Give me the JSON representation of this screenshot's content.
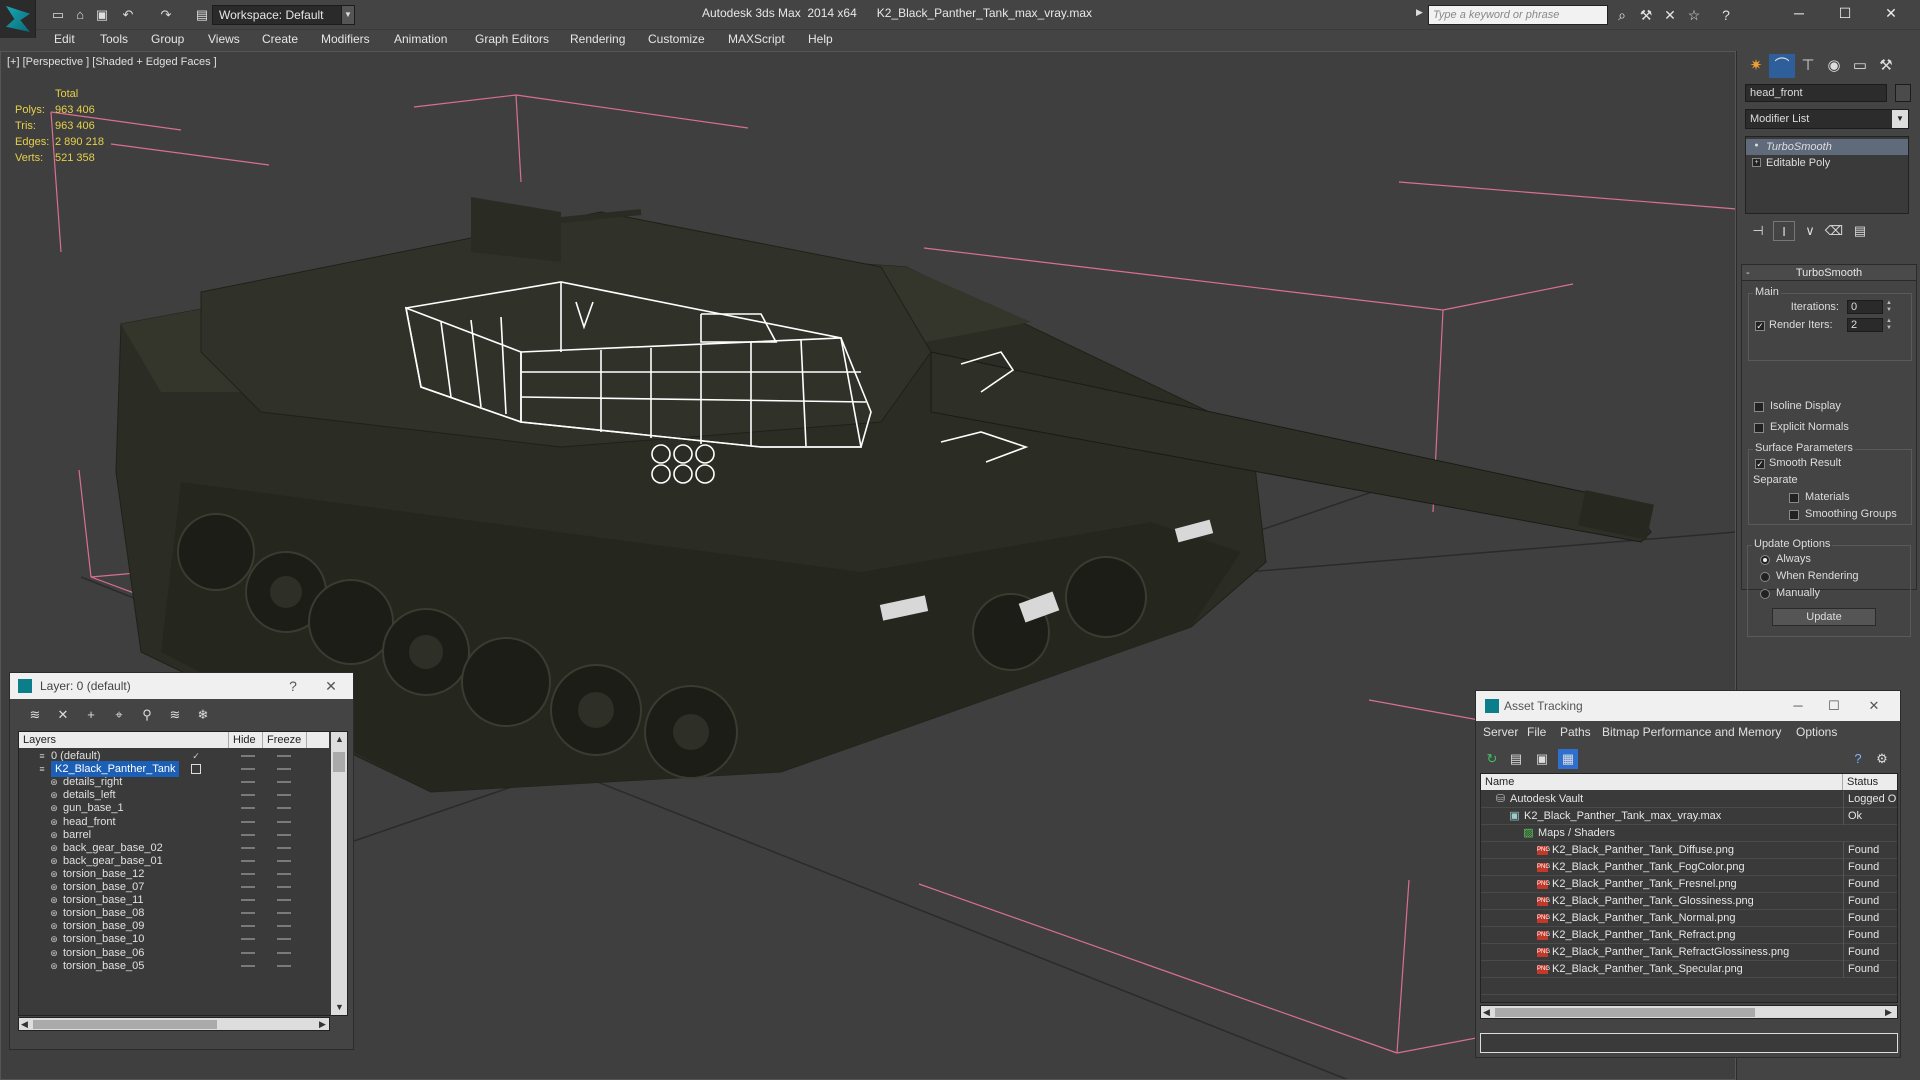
{
  "titlebar": {
    "app_title": "Autodesk 3ds Max  2014 x64      K2_Black_Panther_Tank_max_vray.max",
    "workspace": "Workspace: Default",
    "search_placeholder": "Type a keyword or phrase",
    "icons": [
      "app-logo-icon",
      "new-file-icon",
      "open-file-icon",
      "save-icon",
      "undo-icon",
      "redo-icon",
      "project-folder-icon",
      "binoculars-icon",
      "tools-icon",
      "exchange-icon",
      "star-icon",
      "help-icon",
      "minimize-icon",
      "maximize-icon",
      "close-icon"
    ]
  },
  "menu": {
    "items": [
      "Edit",
      "Tools",
      "Group",
      "Views",
      "Create",
      "Modifiers",
      "Animation",
      "Graph Editors",
      "Rendering",
      "Customize",
      "MAXScript",
      "Help"
    ]
  },
  "viewport": {
    "label": "[+] [Perspective ] [Shaded + Edged Faces ]",
    "stats": {
      "header": "Total",
      "rows": [
        {
          "label": "Polys:",
          "value": "963 406"
        },
        {
          "label": "Tris:",
          "value": "963 406"
        },
        {
          "label": "Edges:",
          "value": "2 890 218"
        },
        {
          "label": "Verts:",
          "value": "521 358"
        }
      ]
    },
    "colors": {
      "stats": "#e6d04a",
      "bbox": "#d9708f",
      "hull": "#2b2d24",
      "wire": "#ffffff"
    }
  },
  "command_panel": {
    "object_name": "head_front",
    "modifier_list": "Modifier List",
    "stack": [
      {
        "label": "TurboSmooth",
        "italic": true
      },
      {
        "label": "Editable Poly",
        "italic": false
      }
    ],
    "rollout": {
      "title": "TurboSmooth",
      "main_group": "Main",
      "iterations_label": "Iterations:",
      "iterations_value": "0",
      "render_iters_label": "Render Iters:",
      "render_iters_value": "2",
      "render_iters_checked": true,
      "isoline_label": "Isoline Display",
      "isoline_checked": false,
      "explicit_normals_label": "Explicit Normals",
      "explicit_normals_checked": false,
      "surface_group": "Surface Parameters",
      "smooth_result_label": "Smooth Result",
      "smooth_result_checked": true,
      "separate_label": "Separate",
      "materials_label": "Materials",
      "smoothing_groups_label": "Smoothing Groups",
      "update_group": "Update Options",
      "always_label": "Always",
      "when_rendering_label": "When Rendering",
      "manually_label": "Manually",
      "selected_update_option": "Always",
      "update_button": "Update"
    }
  },
  "layer_window": {
    "title": "Layer: 0 (default)",
    "help": "?",
    "columns": [
      "Layers",
      "Hide",
      "Freeze"
    ],
    "rows": [
      {
        "name": "0 (default)",
        "level": 0,
        "current": true
      },
      {
        "name": "K2_Black_Panther_Tank",
        "level": 0,
        "selected": true
      },
      {
        "name": "details_right",
        "level": 1
      },
      {
        "name": "details_left",
        "level": 1
      },
      {
        "name": "gun_base_1",
        "level": 1
      },
      {
        "name": "head_front",
        "level": 1
      },
      {
        "name": "barrel",
        "level": 1
      },
      {
        "name": "back_gear_base_02",
        "level": 1
      },
      {
        "name": "back_gear_base_01",
        "level": 1
      },
      {
        "name": "torsion_base_12",
        "level": 1
      },
      {
        "name": "torsion_base_07",
        "level": 1
      },
      {
        "name": "torsion_base_11",
        "level": 1
      },
      {
        "name": "torsion_base_08",
        "level": 1
      },
      {
        "name": "torsion_base_09",
        "level": 1
      },
      {
        "name": "torsion_base_10",
        "level": 1
      },
      {
        "name": "torsion_base_06",
        "level": 1
      },
      {
        "name": "torsion_base_05",
        "level": 1
      }
    ]
  },
  "asset_window": {
    "title": "Asset Tracking",
    "menu": [
      "Server",
      "File",
      "Paths",
      "Bitmap Performance and Memory",
      "Options"
    ],
    "columns": [
      "Name",
      "Status"
    ],
    "rows": [
      {
        "name": "Autodesk Vault",
        "status": "Logged Out",
        "level": 0,
        "icon": "vault"
      },
      {
        "name": "K2_Black_Panther_Tank_max_vray.max",
        "status": "Ok",
        "level": 1,
        "icon": "max"
      },
      {
        "name": "Maps / Shaders",
        "status": "",
        "level": 2,
        "icon": "maps"
      },
      {
        "name": "K2_Black_Panther_Tank_Diffuse.png",
        "status": "Found",
        "level": 3,
        "icon": "png"
      },
      {
        "name": "K2_Black_Panther_Tank_FogColor.png",
        "status": "Found",
        "level": 3,
        "icon": "png"
      },
      {
        "name": "K2_Black_Panther_Tank_Fresnel.png",
        "status": "Found",
        "level": 3,
        "icon": "png"
      },
      {
        "name": "K2_Black_Panther_Tank_Glossiness.png",
        "status": "Found",
        "level": 3,
        "icon": "png"
      },
      {
        "name": "K2_Black_Panther_Tank_Normal.png",
        "status": "Found",
        "level": 3,
        "icon": "png"
      },
      {
        "name": "K2_Black_Panther_Tank_Refract.png",
        "status": "Found",
        "level": 3,
        "icon": "png"
      },
      {
        "name": "K2_Black_Panther_Tank_RefractGlossiness.png",
        "status": "Found",
        "level": 3,
        "icon": "png"
      },
      {
        "name": "K2_Black_Panther_Tank_Specular.png",
        "status": "Found",
        "level": 3,
        "icon": "png"
      }
    ]
  }
}
